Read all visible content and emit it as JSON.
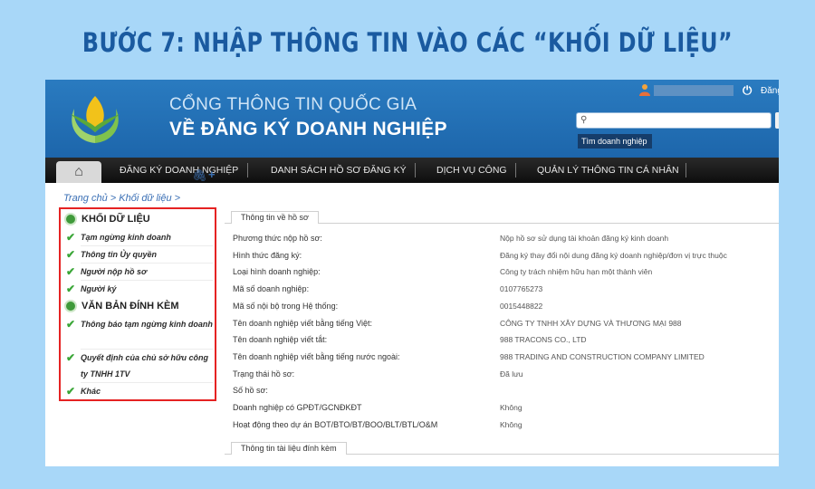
{
  "headline": "BƯỚC 7: NHẬP THÔNG TIN VÀO CÁC “KHỐI DỮ LIỆU”",
  "portal": {
    "line1": "CỔNG THÔNG TIN QUỐC GIA",
    "line2": "VỀ ĐĂNG KÝ DOANH NGHIỆP",
    "login_link": "Đăng",
    "search_label": "Tìm doanh nghiệp"
  },
  "nav": {
    "items": [
      "ĐĂNG KÝ DOANH NGHIỆP",
      "DANH SÁCH HỒ SƠ ĐĂNG KÝ",
      "DỊCH VỤ CÔNG",
      "QUẢN LÝ THÔNG TIN CÁ NHÂN"
    ]
  },
  "breadcrumb": "Trang chủ > Khối dữ liệu >",
  "sidebar": {
    "section1": "KHỐI DỮ LIỆU",
    "section1_items": [
      "Tạm ngừng kinh doanh",
      "Thông tin Ủy quyền",
      "Người nộp hồ sơ",
      "Người ký"
    ],
    "section2": "VĂN BẢN ĐÍNH KÈM",
    "section2_items": [
      "Thông báo tạm ngừng kinh doanh",
      "Quyết định của chủ sở hữu công ty TNHH 1TV",
      "Khác"
    ]
  },
  "panel": {
    "tab1": "Thông tin về hồ sơ",
    "tab2": "Thông tin tài liệu đính kèm",
    "rows": [
      {
        "label": "Phương thức nộp hồ sơ:",
        "value": "Nộp hồ sơ sử dụng tài khoản đăng ký kinh doanh"
      },
      {
        "label": "Hình thức đăng ký:",
        "value": "Đăng ký thay đổi nội dung đăng ký doanh nghiệp/đơn vị trực thuộc"
      },
      {
        "label": "Loại hình doanh nghiệp:",
        "value": "Công ty trách nhiệm hữu hạn một thành viên"
      },
      {
        "label": "Mã số doanh nghiệp:",
        "value": "0107765273"
      },
      {
        "label": "Mã số nội bộ trong Hệ thống:",
        "value": "0015448822"
      },
      {
        "label": "Tên doanh nghiệp viết bằng tiếng Việt:",
        "value": "CÔNG TY TNHH XÂY DỰNG VÀ THƯƠNG MẠI 988"
      },
      {
        "label": "Tên doanh nghiệp viết tắt:",
        "value": "988 TRACONS CO., LTD"
      },
      {
        "label": "Tên doanh nghiệp viết bằng tiếng nước ngoài:",
        "value": "988 TRADING AND CONSTRUCTION COMPANY LIMITED"
      },
      {
        "label": "Trạng thái hồ sơ:",
        "value": "Đã lưu"
      },
      {
        "label": "Số hồ sơ:",
        "value": ""
      },
      {
        "label": "Doanh nghiệp có GPĐT/GCNĐKĐT",
        "value": "Không"
      },
      {
        "label": "Hoạt động theo dự án BOT/BTO/BT/BOO/BLT/BTL/O&M",
        "value": "Không"
      }
    ]
  }
}
